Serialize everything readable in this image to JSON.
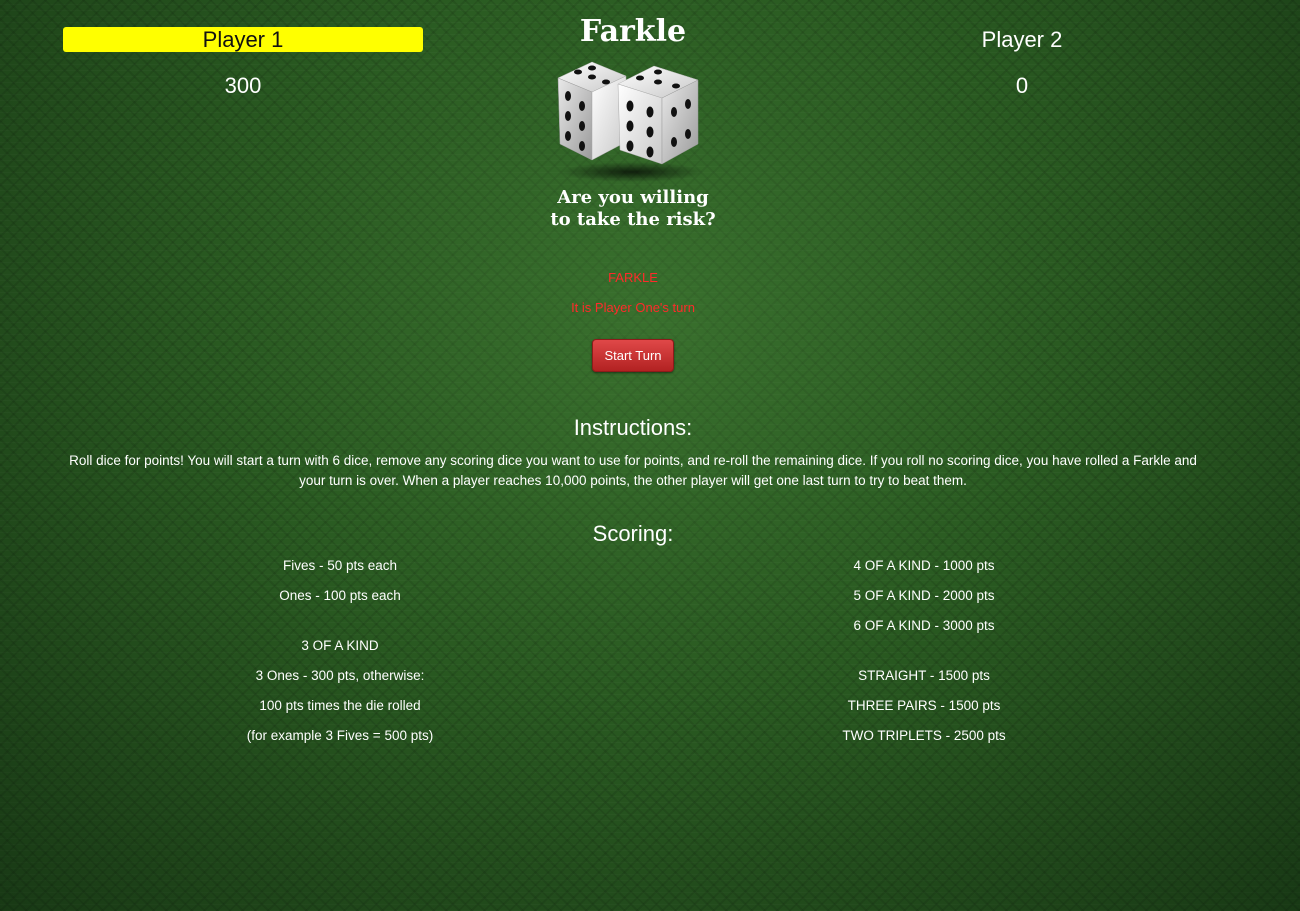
{
  "header": {
    "title": "Farkle",
    "tagline_line1": "Are you willing",
    "tagline_line2": "to take the risk?"
  },
  "players": {
    "player1": {
      "name": "Player 1",
      "score": "300",
      "highlight_color": "#ffff00"
    },
    "player2": {
      "name": "Player 2",
      "score": "0"
    }
  },
  "status": {
    "line1": "FARKLE",
    "line2": "It is Player One's turn",
    "color": "#ff2a2a"
  },
  "controls": {
    "start_turn_label": "Start Turn",
    "button_color": "#c62828"
  },
  "instructions": {
    "heading": "Instructions:",
    "text": "Roll dice for points! You will start a turn with 6 dice, remove any scoring dice you want to use for points, and re-roll the remaining dice. If you roll no scoring dice, you have rolled a Farkle and your turn is over. When a player reaches 10,000 points, the other player will get one last turn to try to beat them."
  },
  "scoring": {
    "heading": "Scoring:",
    "left": [
      "Fives - 50 pts each",
      "Ones - 100 pts each",
      "3 OF A KIND",
      "3 Ones - 300 pts, otherwise:",
      "100 pts times the die rolled",
      "(for example 3 Fives = 500 pts)"
    ],
    "right": [
      "4 OF A KIND - 1000 pts",
      "5 OF A KIND - 2000 pts",
      "6 OF A KIND - 3000 pts",
      "STRAIGHT - 1500 pts",
      "THREE PAIRS - 1500 pts",
      "TWO TRIPLETS - 2500 pts"
    ]
  },
  "colors": {
    "background": "#2a5a22",
    "text": "#ffffff"
  }
}
